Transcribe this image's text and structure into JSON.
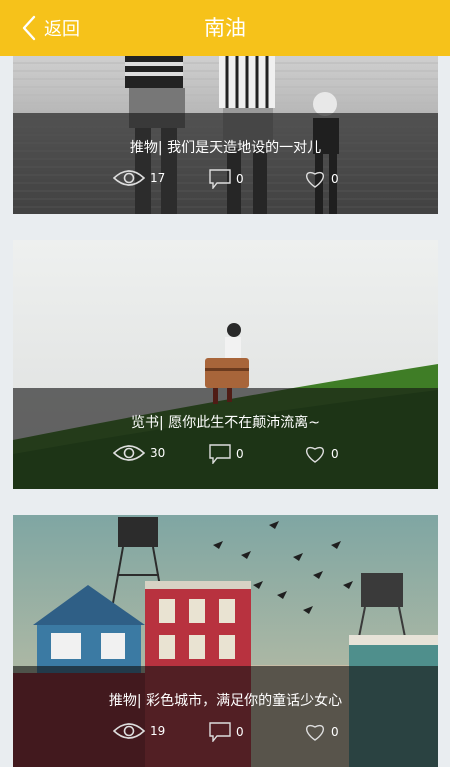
{
  "header": {
    "back_label": "返回",
    "title": "南油"
  },
  "cards": [
    {
      "caption": "推物| 我们是天造地设的一对儿",
      "views": "17",
      "comments": "0",
      "likes": "0"
    },
    {
      "caption": "览书| 愿你此生不在颠沛流离~",
      "views": "30",
      "comments": "0",
      "likes": "0"
    },
    {
      "caption": "推物| 彩色城市，满足你的童话少女心",
      "views": "19",
      "comments": "0",
      "likes": "0"
    }
  ],
  "colors": {
    "header": "#f6c21a",
    "background": "#e9edf0",
    "overlay": "rgba(20,20,20,0.62)"
  }
}
